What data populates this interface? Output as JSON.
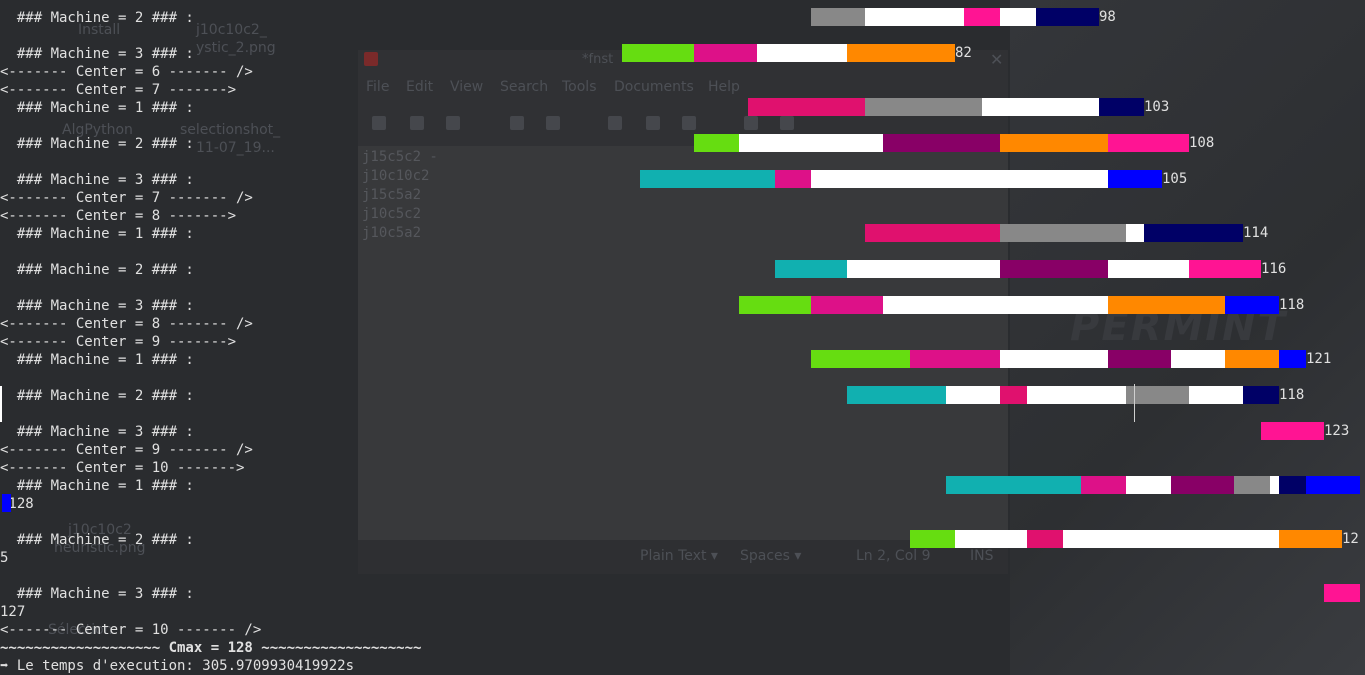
{
  "terminal": {
    "lines": [
      "  ### Machine = 2 ### :",
      "",
      "  ### Machine = 3 ### :",
      "<------- Center = 6 ------- />",
      "<------- Center = 7 ------->",
      "  ### Machine = 1 ### :",
      "",
      "  ### Machine = 2 ### :",
      "",
      "  ### Machine = 3 ### :",
      "<------- Center = 7 ------- />",
      "<------- Center = 8 ------->",
      "  ### Machine = 1 ### :",
      "",
      "  ### Machine = 2 ### :",
      "",
      "  ### Machine = 3 ### :",
      "<------- Center = 8 ------- />",
      "<------- Center = 9 ------->",
      "  ### Machine = 1 ### :",
      "",
      "  ### Machine = 2 ### :",
      "",
      "  ### Machine = 3 ### :",
      "<------- Center = 9 ------- />",
      "<------- Center = 10 ------->",
      "  ### Machine = 1 ### :",
      " 128",
      "",
      "  ### Machine = 2 ### :",
      "5",
      "",
      "  ### Machine = 3 ### :",
      "127",
      "<------- Center = 10 ------- />",
      "~~~~~~~~~~~~~~~~~~~ Cmax = 128 ~~~~~~~~~~~~~~~~~~~",
      "➡ Le temps d'execution: 305.9709930419922s"
    ]
  },
  "gantt": {
    "rows": [
      {
        "label": "98",
        "segments": [
          "#888888",
          "#ffffff",
          "#ff1493",
          "#ffffff",
          "#000066"
        ]
      },
      {
        "label": "82",
        "segments": [
          "#66dd11",
          "#dd1188",
          "#ffffff",
          "#ff8800"
        ]
      },
      {
        "label": "103",
        "segments": [
          "#e0116e",
          "#888888",
          "#ffffff",
          "#000066"
        ]
      },
      {
        "label": "108",
        "segments": [
          "#66dd11",
          "#ffffff",
          "#880066",
          "#ff8800",
          "#ff1493"
        ]
      },
      {
        "label": "105",
        "segments": [
          "#11b0b0",
          "#dd1188",
          "#ffffff",
          "#0000ff"
        ]
      },
      {
        "label": "114",
        "segments": [
          "#e0116e",
          "#888888",
          "#ffffff",
          "#000066"
        ]
      },
      {
        "label": "116",
        "segments": [
          "#11b0b0",
          "#ffffff",
          "#880066",
          "#ffffff",
          "#ff1493"
        ]
      },
      {
        "label": "118",
        "segments": [
          "#66dd11",
          "#dd1188",
          "#ffffff",
          "#ff8800",
          "#0000ff"
        ]
      },
      {
        "label": "121",
        "segments": [
          "#66dd11",
          "#dd1188",
          "#ffffff",
          "#880066",
          "#ffffff",
          "#ff8800",
          "#0000ff"
        ]
      },
      {
        "label": "118",
        "segments": [
          "#11b0b0",
          "#ffffff",
          "#e0116e",
          "#ffffff",
          "#888888",
          "#ffffff",
          "#000066"
        ]
      },
      {
        "label": "123",
        "segments": [
          "#ff1493"
        ]
      },
      {
        "label": "",
        "segments": [
          "#11b0b0",
          "#dd1188",
          "#ffffff",
          "#880066",
          "#888888",
          "#ffffff",
          "#000066",
          "#0000ff"
        ]
      },
      {
        "label": "12",
        "segments": [
          "#66dd11",
          "#ffffff",
          "#e0116e",
          "#ffffff",
          "#ff8800"
        ]
      },
      {
        "label": "",
        "segments": [
          "#ff1493"
        ]
      },
      {
        "label": "",
        "segments": [
          "#0000ff"
        ]
      }
    ]
  },
  "background_window": {
    "menu": [
      "File",
      "Edit",
      "View",
      "Search",
      "Tools",
      "Documents",
      "Help"
    ],
    "title": "*fnst",
    "doc_lines": [
      "j15c5c2 -",
      "j10c10c2",
      "j15c5a2",
      "j10c5c2",
      "j10c5a2"
    ],
    "status": [
      "Plain Text ▾",
      "Spaces ▾",
      "Ln 2, Col 9",
      "INS"
    ],
    "desktop_icons": [
      "Install",
      "j10c10c2_",
      "ystic_2.png",
      "AlgPython",
      "selectionshot_",
      "11-07_19...",
      "j10c10c2",
      "heuristic.png",
      "Sélection"
    ],
    "watermark": "PERMINT"
  }
}
